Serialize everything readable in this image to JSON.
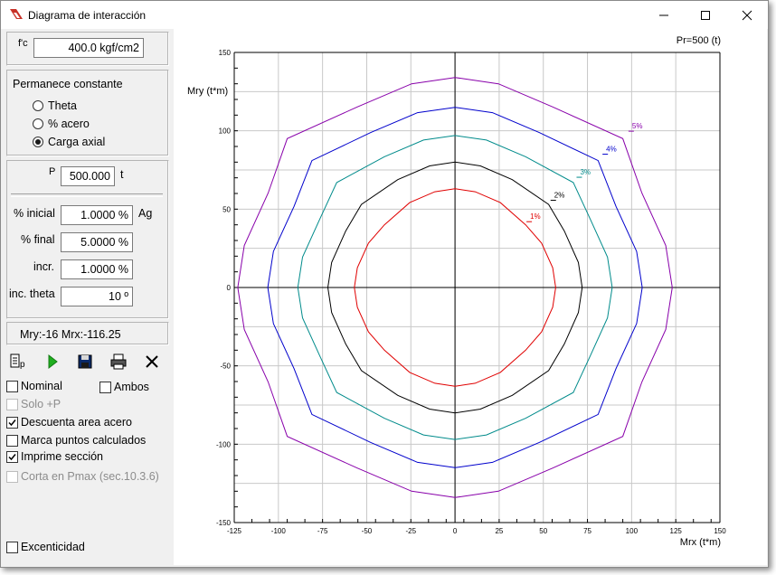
{
  "window": {
    "title": "Diagrama de interacción",
    "minimize_icon": "minimize-icon",
    "maximize_icon": "maximize-icon",
    "close_icon": "close-icon"
  },
  "left_panel": {
    "fc_label": "f'c",
    "fc_value": "400.0 kgf/cm2",
    "constant_title": "Permanece constante",
    "radio_options": [
      {
        "label": "Theta",
        "selected": false
      },
      {
        "label": "% acero",
        "selected": false
      },
      {
        "label": "Carga axial",
        "selected": true
      }
    ],
    "p_label": "P",
    "p_value": "500.000",
    "p_unit": "t",
    "pct_inicial_label": "% inicial",
    "pct_inicial_value": "1.0000 %",
    "pct_inicial_unit": "Ag",
    "pct_final_label": "% final",
    "pct_final_value": "5.0000 %",
    "incr_label": "incr.",
    "incr_value": "1.0000 %",
    "inc_theta_label": "inc. theta",
    "inc_theta_value": "10 º",
    "status_text": "Mry:-16 Mrx:-116.25",
    "toolbar": [
      {
        "name": "section-icon",
        "label": "p"
      },
      {
        "name": "play-icon",
        "label": ""
      },
      {
        "name": "save-icon",
        "label": ""
      },
      {
        "name": "print-icon",
        "label": ""
      },
      {
        "name": "close-x-icon",
        "label": ""
      }
    ],
    "checkboxes": {
      "nominal": {
        "label": "Nominal",
        "checked": false,
        "enabled": true
      },
      "ambos": {
        "label": "Ambos",
        "checked": false,
        "enabled": true
      },
      "solo_p": {
        "label": "Solo +P",
        "checked": false,
        "enabled": false
      },
      "descuenta": {
        "label": "Descuenta area acero",
        "checked": true,
        "enabled": true
      },
      "marca": {
        "label": "Marca puntos calculados",
        "checked": false,
        "enabled": true
      },
      "imprime": {
        "label": "Imprime sección",
        "checked": true,
        "enabled": true
      },
      "corta": {
        "label": "Corta en Pmax (sec.10.3.6)",
        "checked": false,
        "enabled": false
      },
      "excentricidad": {
        "label": "Excenticidad",
        "checked": false,
        "enabled": true
      }
    }
  },
  "chart_data": {
    "type": "line",
    "corner_label": "Pr=500 (t)",
    "xlabel": "Mrx (t*m)",
    "ylabel": "Mry (t*m)",
    "xlim": [
      -125,
      150
    ],
    "ylim": [
      -150,
      150
    ],
    "x_ticks": [
      "-125",
      "-100",
      "-75",
      "-50",
      "-25",
      "0",
      "25",
      "50",
      "75",
      "100",
      "125",
      "150"
    ],
    "y_ticks": [
      "150",
      "100",
      "50",
      "0",
      "-50",
      "-100",
      "-150"
    ],
    "grid": true,
    "series": [
      {
        "name": "1%",
        "color": "#e00000",
        "mx": 57,
        "my": 63,
        "mid": 40,
        "label_angle": 45
      },
      {
        "name": "2%",
        "color": "#000000",
        "mx": 72,
        "my": 80,
        "mid": 53,
        "label_angle": 45
      },
      {
        "name": "3%",
        "color": "#008b8b",
        "mx": 89,
        "my": 97,
        "mid": 67,
        "label_angle": 45
      },
      {
        "name": "4%",
        "color": "#0000cc",
        "mx": 106,
        "my": 115,
        "mid": 81,
        "label_angle": 45
      },
      {
        "name": "5%",
        "color": "#8800aa",
        "mx": 123,
        "my": 134,
        "mid": 95,
        "label_angle": 45
      }
    ]
  }
}
